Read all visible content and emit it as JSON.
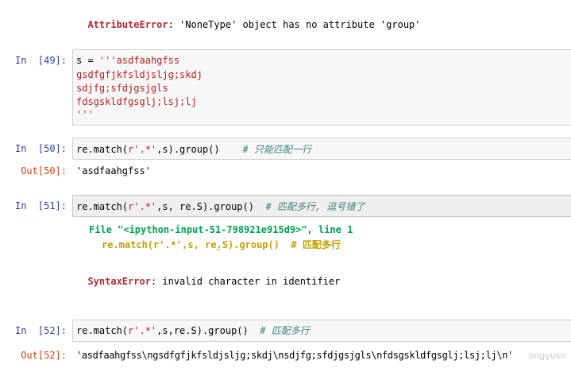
{
  "top_error": {
    "name": "AttributeError",
    "message": ": 'NoneType' object has no attribute 'group'"
  },
  "cells": [
    {
      "prompt": "In  [49]:",
      "lines": [
        {
          "pre": "s = ",
          "str": "'''asdfaahgfss"
        },
        {
          "str": "gsdfgfjkfsldjsljg;skdj"
        },
        {
          "str": "sdjfg;sfdjgsjgls"
        },
        {
          "str": "fdsgskldfgsglj;lsj;lj"
        },
        {
          "str": "'''"
        }
      ]
    },
    {
      "prompt": "In  [50]:",
      "code_pre": "re.match(",
      "code_str": "r'.*'",
      "code_post": ",s).group()",
      "comment": "# 只能匹配一行",
      "out_prompt": "Out[50]:",
      "output": "'asdfaahgfss'"
    },
    {
      "prompt": "In  [51]:",
      "code_pre": "re.match(",
      "code_str": "r'.*'",
      "code_post": ",s, re.S).group()",
      "comment": "# 匹配多行, 逗号错了",
      "traceback_file": "File \"<ipython-input-51-798921e915d9>\", line 1",
      "traceback_code": "re.match(r'.*',s, re.S).group()  # 匹配多行",
      "traceback_caret": "^",
      "error_name": "SyntaxError",
      "error_message": ": invalid character in identifier"
    },
    {
      "prompt": "In  [52]:",
      "code_pre": "re.match(",
      "code_str": "r'.*'",
      "code_post": ",s,re.S).group()",
      "comment": "# 匹配多行",
      "out_prompt": "Out[52]:",
      "output": "'asdfaahgfss\\ngsdfgfjkfsldjsljg;skdj\\nsdjfg;sfdjgsjgls\\nfdsgskldfgsglj;lsj;lj\\n'"
    }
  ],
  "watermark": "ongyusir"
}
